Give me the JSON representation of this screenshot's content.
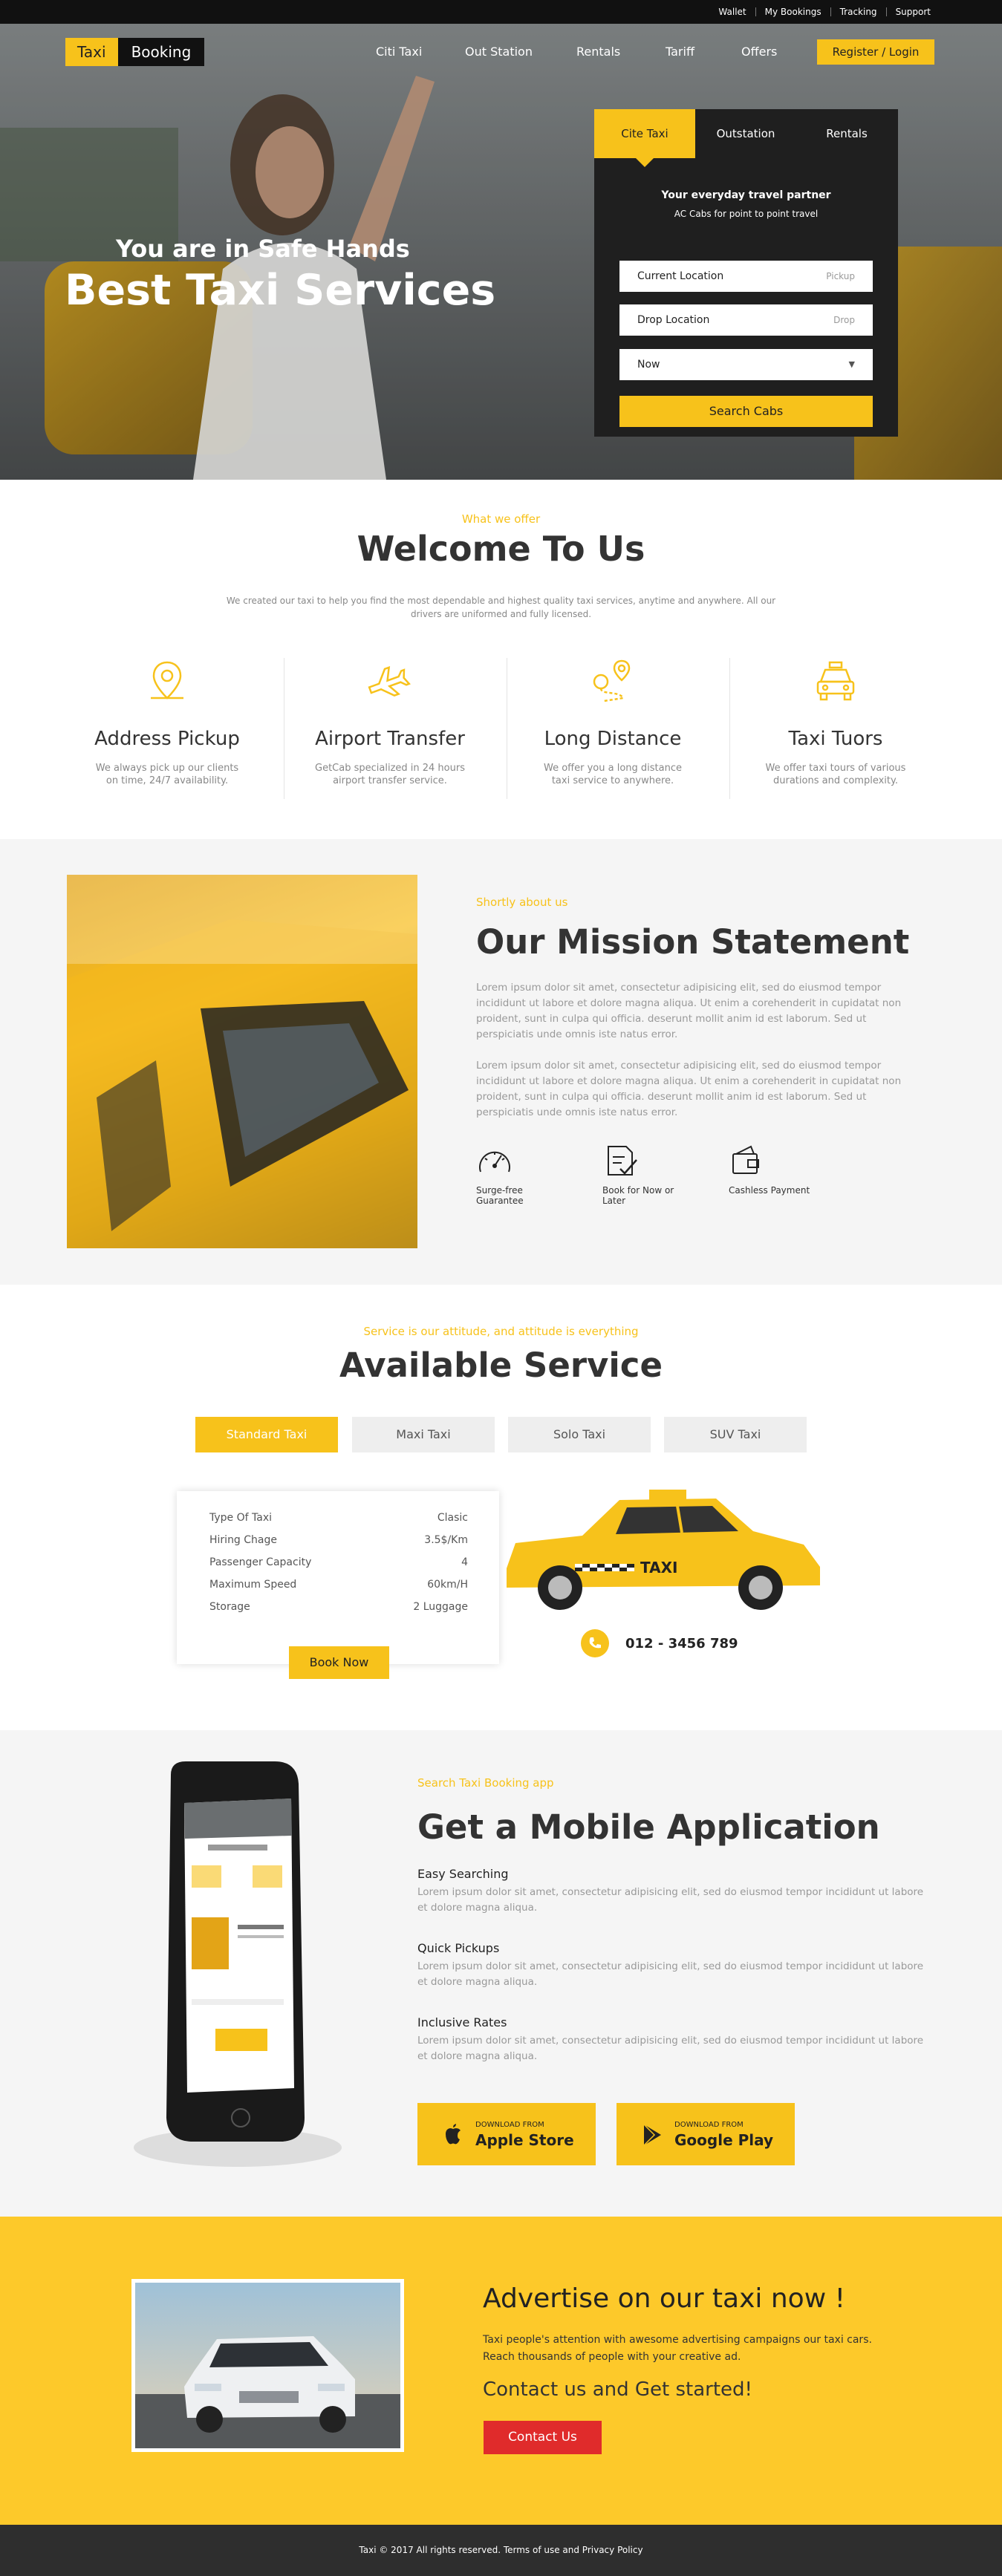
{
  "topbar": {
    "links": [
      "Wallet",
      "My Bookings",
      "Tracking",
      "Support"
    ]
  },
  "header": {
    "logo_part1": "Taxi",
    "logo_part2": "Booking",
    "nav": [
      "Citi Taxi",
      "Out Station",
      "Rentals",
      "Tariff",
      "Offers"
    ],
    "register": "Register / Login"
  },
  "hero": {
    "line1": "You are in Safe Hands",
    "line2": "Best Taxi Services",
    "panel": {
      "tabs": [
        "Cite Taxi",
        "Outstation",
        "Rentals"
      ],
      "heading": "Your everyday travel partner",
      "sub": "AC Cabs for point to point travel",
      "fields": [
        {
          "value": "Current Location",
          "hint": "Pickup"
        },
        {
          "value": "Drop  Location",
          "hint": "Drop"
        }
      ],
      "time_select": "Now",
      "search_button": "Search Cabs"
    }
  },
  "welcome": {
    "kicker": "What we offer",
    "title": "Welcome To Us",
    "text": "We created our taxi to help you find the most dependable and highest quality taxi services, anytime and anywhere. All our drivers are uniformed and fully licensed.",
    "features": [
      {
        "title": "Address Pickup",
        "desc": "We always pick up our clients on time, 24/7 availability.",
        "icon": "location-pin-icon"
      },
      {
        "title": "Airport Transfer",
        "desc": "GetCab specialized in 24 hours airport transfer service.",
        "icon": "airplane-icon"
      },
      {
        "title": "Long Distance",
        "desc": "We offer you a long distance taxi service to anywhere.",
        "icon": "route-icon"
      },
      {
        "title": "Taxi Tuors",
        "desc": "We offer taxi tours of various durations and complexity.",
        "icon": "taxi-icon"
      }
    ]
  },
  "mission": {
    "kicker": "Shortly about us",
    "title": "Our Mission Statement",
    "para1": "Lorem ipsum dolor sit amet, consectetur adipisicing elit, sed do eiusmod tempor incididunt ut labore et dolore magna aliqua. Ut enim a corehenderit in cupidatat non proident, sunt in culpa qui officia. deserunt mollit anim id est laborum. Sed ut perspiciatis unde omnis iste natus error.",
    "para2": "Lorem ipsum dolor sit amet, consectetur adipisicing elit, sed do eiusmod tempor incididunt ut labore et dolore magna aliqua. Ut enim a corehenderit in cupidatat non proident, sunt in culpa qui officia. deserunt mollit anim id est laborum. Sed ut perspiciatis unde omnis iste natus error.",
    "features": [
      "Surge-free Guarantee",
      "Book for Now or Later",
      "Cashless Payment"
    ]
  },
  "services": {
    "kicker": "Service is our attitude, and attitude is everything",
    "title": "Available Service",
    "tabs": [
      "Standard Taxi",
      "Maxi Taxi",
      "Solo Taxi",
      "SUV Taxi"
    ],
    "specs": [
      {
        "label": "Type Of Taxi",
        "value": "Clasic"
      },
      {
        "label": "Hiring Chage",
        "value": "3.5$/Km"
      },
      {
        "label": "Passenger Capacity",
        "value": "4"
      },
      {
        "label": "Maximum Speed",
        "value": "60km/H"
      },
      {
        "label": "Storage",
        "value": "2 Luggage"
      }
    ],
    "book_button": "Book Now",
    "taxi_sign": "TAXI",
    "phone": "012 - 3456 789"
  },
  "app": {
    "kicker": "Search Taxi Booking app",
    "title": "Get a Mobile Application",
    "features": [
      {
        "title": "Easy Searching",
        "desc": "Lorem ipsum dolor sit amet, consectetur adipisicing elit, sed do eiusmod tempor incididunt ut labore et dolore magna aliqua."
      },
      {
        "title": "Quick Pickups",
        "desc": "Lorem ipsum dolor sit amet, consectetur adipisicing elit, sed do eiusmod tempor incididunt ut labore et dolore magna aliqua."
      },
      {
        "title": "Inclusive Rates",
        "desc": "Lorem ipsum dolor sit amet, consectetur adipisicing elit, sed do eiusmod tempor incididunt ut labore et dolore magna aliqua."
      }
    ],
    "stores": [
      {
        "small": "DOWNLOAD FROM",
        "name": "Apple Store",
        "icon": "apple-icon"
      },
      {
        "small": "DOWNLOAD FROM",
        "name": "Google Play",
        "icon": "google-play-icon"
      }
    ]
  },
  "advert": {
    "title": "Advertise on our taxi now !",
    "text": "Taxi people's attention with awesome advertising campaigns our taxi cars. Reach thousands of people with your creative ad.",
    "cta": "Contact us and Get started!",
    "button": "Contact Us"
  },
  "footer": {
    "text": "Taxi © 2017 All rights reserved. Terms of use and Privacy Policy"
  },
  "colors": {
    "accent": "#f7c21b",
    "dark": "#1f1f1f",
    "red": "#e02b2b",
    "advert_bg": "#fdc92a"
  }
}
